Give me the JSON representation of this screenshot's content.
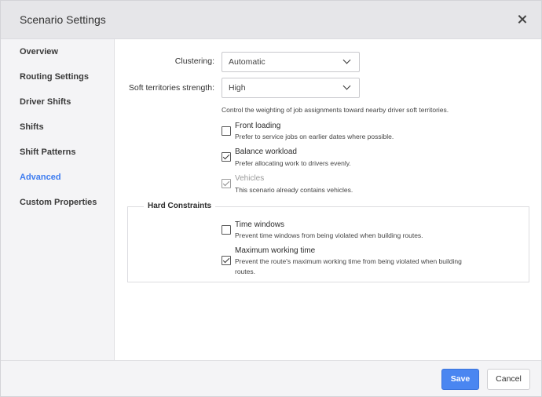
{
  "dialog": {
    "title": "Scenario Settings"
  },
  "sidebar": {
    "items": [
      {
        "label": "Overview",
        "active": false
      },
      {
        "label": "Routing Settings",
        "active": false
      },
      {
        "label": "Driver Shifts",
        "active": false
      },
      {
        "label": "Shifts",
        "active": false
      },
      {
        "label": "Shift Patterns",
        "active": false
      },
      {
        "label": "Advanced",
        "active": true
      },
      {
        "label": "Custom Properties",
        "active": false
      }
    ]
  },
  "form": {
    "clustering": {
      "label": "Clustering:",
      "value": "Automatic"
    },
    "soft_territories": {
      "label": "Soft territories strength:",
      "value": "High"
    },
    "soft_territories_hint": "Control the weighting of job assignments toward nearby driver soft territories.",
    "options": [
      {
        "title": "Front loading",
        "desc": "Prefer to service jobs on earlier dates where possible.",
        "checked": false,
        "disabled": false
      },
      {
        "title": "Balance workload",
        "desc": "Prefer allocating work to drivers evenly.",
        "checked": true,
        "disabled": false
      },
      {
        "title": "Vehicles",
        "desc": "This scenario already contains vehicles.",
        "checked": true,
        "disabled": true
      }
    ],
    "hard_constraints": {
      "legend": "Hard Constraints",
      "options": [
        {
          "title": "Time windows",
          "desc": "Prevent time windows from being violated when building routes.",
          "checked": false
        },
        {
          "title": "Maximum working time",
          "desc": "Prevent the route's maximum working time from being violated when building routes.",
          "checked": true
        }
      ]
    }
  },
  "footer": {
    "save_label": "Save",
    "cancel_label": "Cancel"
  },
  "colors": {
    "accent": "#3d7cf0",
    "save_button": "#4a86f1",
    "header_bg": "#e6e6e9",
    "sidebar_bg": "#f4f4f6"
  }
}
